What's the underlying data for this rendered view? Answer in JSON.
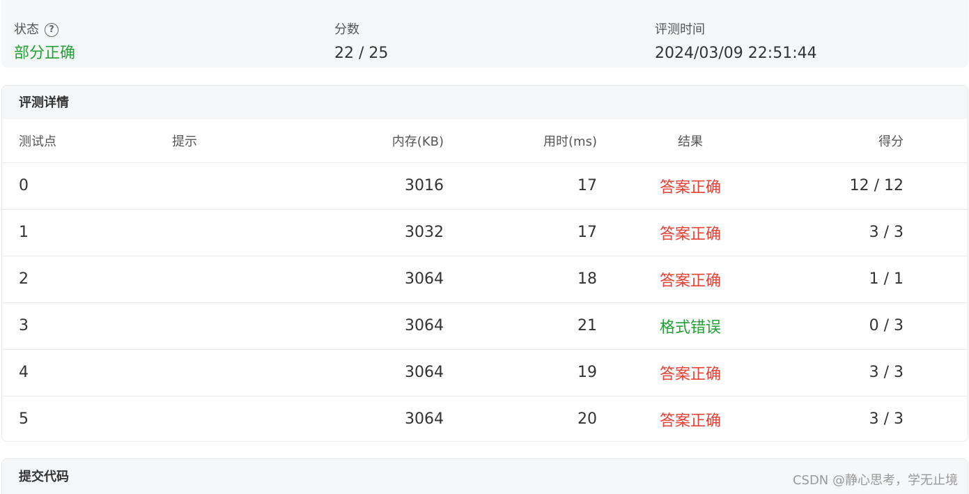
{
  "summary": {
    "status_label": "状态",
    "status_value": "部分正确",
    "score_label": "分数",
    "score_value": "22 / 25",
    "time_label": "评测时间",
    "time_value": "2024/03/09 22:51:44"
  },
  "details": {
    "title": "评测详情",
    "columns": {
      "id": "测试点",
      "hint": "提示",
      "memory": "内存(KB)",
      "time": "用时(ms)",
      "result": "结果",
      "score": "得分"
    },
    "rows": [
      {
        "id": "0",
        "hint": "",
        "memory": "3016",
        "time": "17",
        "result": "答案正确",
        "score": "12 / 12"
      },
      {
        "id": "1",
        "hint": "",
        "memory": "3032",
        "time": "17",
        "result": "答案正确",
        "score": "3 / 3"
      },
      {
        "id": "2",
        "hint": "",
        "memory": "3064",
        "time": "18",
        "result": "答案正确",
        "score": "1 / 1"
      },
      {
        "id": "3",
        "hint": "",
        "memory": "3064",
        "time": "21",
        "result": "格式错误",
        "score": "0 / 3"
      },
      {
        "id": "4",
        "hint": "",
        "memory": "3064",
        "time": "19",
        "result": "答案正确",
        "score": "3 / 3"
      },
      {
        "id": "5",
        "hint": "",
        "memory": "3064",
        "time": "20",
        "result": "答案正确",
        "score": "3 / 3"
      }
    ]
  },
  "code": {
    "title": "提交代码"
  },
  "watermark": "CSDN @静心思考，学无止境",
  "colors": {
    "accepted": "#e84035",
    "format_error": "#22a234",
    "partial": "#22a234"
  }
}
